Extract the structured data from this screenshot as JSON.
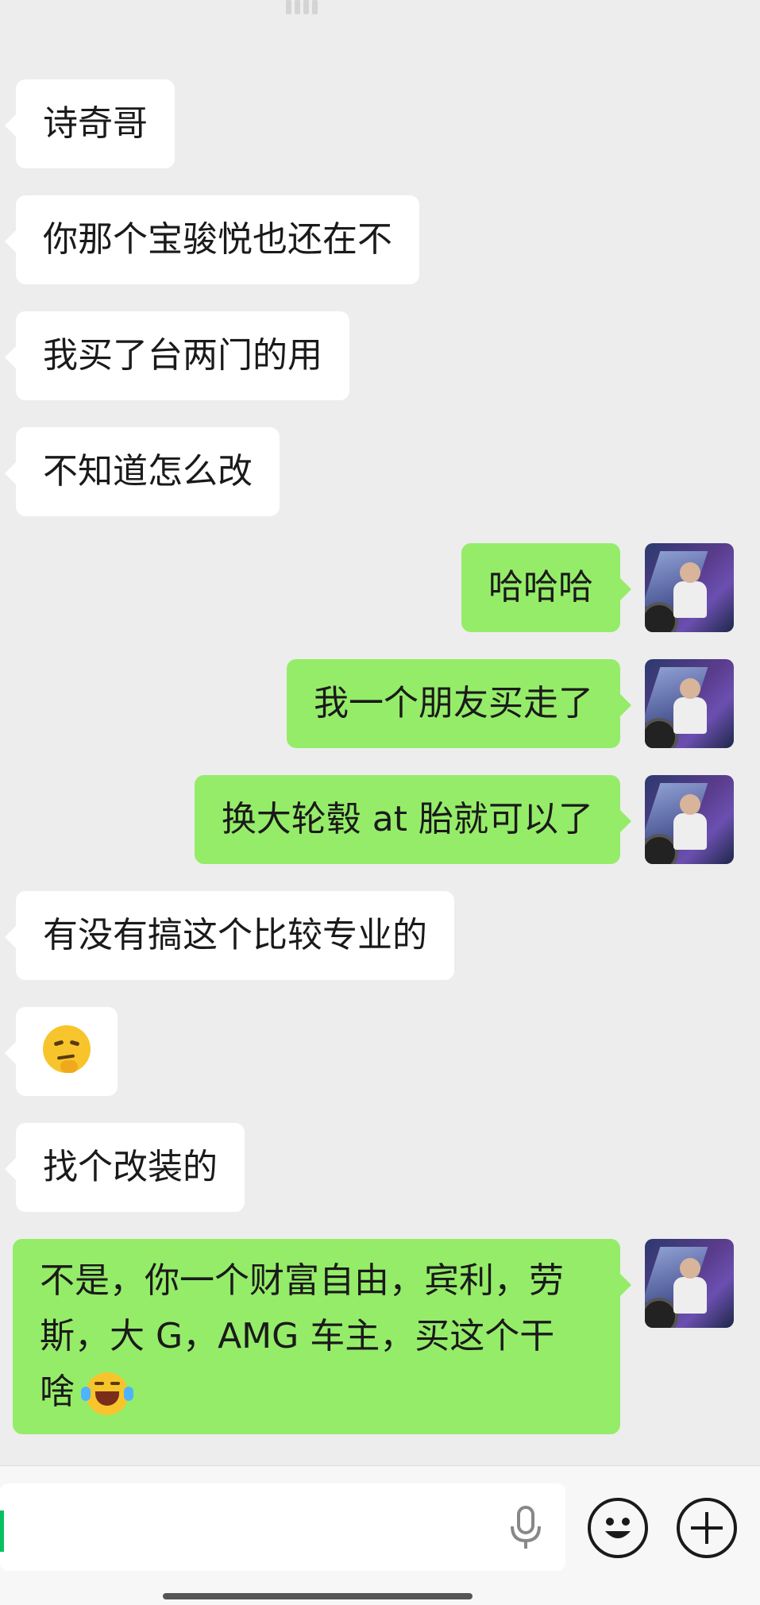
{
  "messages": [
    {
      "side": "in",
      "text": "诗奇哥"
    },
    {
      "side": "in",
      "text": "你那个宝骏悦也还在不"
    },
    {
      "side": "in",
      "text": "我买了台两门的用"
    },
    {
      "side": "in",
      "text": "不知道怎么改"
    },
    {
      "side": "out",
      "text": "哈哈哈"
    },
    {
      "side": "out",
      "text": "我一个朋友买走了"
    },
    {
      "side": "out",
      "text": "换大轮毂 at 胎就可以了"
    },
    {
      "side": "in",
      "text": "有没有搞这个比较专业的"
    },
    {
      "side": "in",
      "text": "",
      "emoji": "thinking-face"
    },
    {
      "side": "in",
      "text": "找个改装的"
    },
    {
      "side": "out",
      "lines": [
        "不是，你一个财富自由，宾利，劳",
        "斯，大 G，AMG 车主，买这个干",
        "啥"
      ],
      "emoji": "tears-of-joy"
    }
  ],
  "colors": {
    "incoming": "#ffffff",
    "outgoing": "#95ec69",
    "background": "#ededed",
    "cursor": "#07c160"
  },
  "input": {
    "value": "",
    "icons": [
      "microphone-icon",
      "emoji-icon",
      "plus-icon"
    ]
  }
}
